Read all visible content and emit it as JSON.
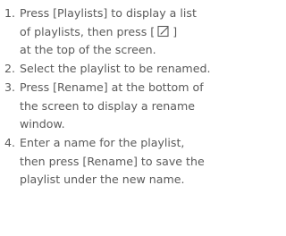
{
  "steps": [
    {
      "number": "1.",
      "lines": [
        "Press [Playlists] to display a list",
        "of playlists, then press [",
        "]",
        "at the top of the screen."
      ]
    },
    {
      "number": "2.",
      "lines": [
        "Select the playlist to be renamed."
      ]
    },
    {
      "number": "3.",
      "lines": [
        "Press [Rename] at the bottom of",
        "the screen to display a rename",
        "window."
      ]
    },
    {
      "number": "4.",
      "lines": [
        "Enter a name for the playlist,",
        "then press [Rename] to save the",
        "playlist under the new name."
      ]
    }
  ],
  "icons": {
    "edit_icon": "edit-icon",
    "color": "#5a5a5a"
  }
}
